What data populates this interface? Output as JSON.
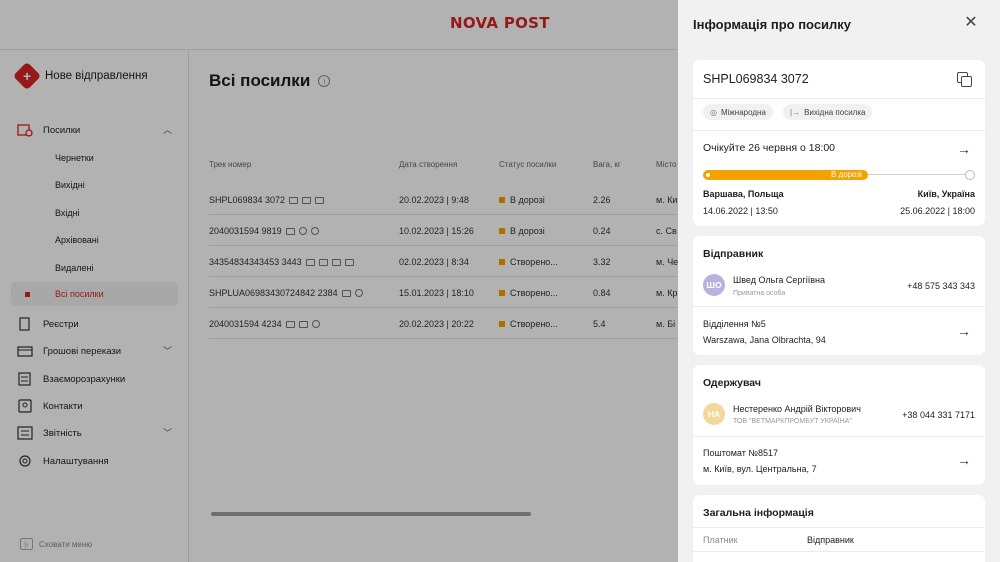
{
  "header": {
    "logo": "NOVA POST"
  },
  "sidebar": {
    "new_shipment": "Нове відправлення",
    "parcels": "Посилки",
    "sub_items": [
      "Чернетки",
      "Вихідні",
      "Вхідні",
      "Архівовані",
      "Видалені"
    ],
    "active_sub": "Всі посилки",
    "items": [
      "Реєстри",
      "Грошові перекази",
      "Взаєморозрахунки",
      "Контакти",
      "Звітність",
      "Налаштування"
    ],
    "hide_menu": "Сховати меню"
  },
  "main": {
    "title": "Всі посилки",
    "columns": [
      "Трек номер",
      "Дата  створення",
      "Статус посилки",
      "Вага, кг",
      "Місто"
    ],
    "rows": [
      {
        "track": "SHPL069834 3072",
        "date": "20.02.2023 | 9:48",
        "status": "В дорозі",
        "weight": "2.26",
        "city": "м. Ки"
      },
      {
        "track": "2040031594 9819",
        "date": "10.02.2023 | 15:26",
        "status": "В дорозі",
        "weight": "0.24",
        "city": "с. Св"
      },
      {
        "track": "34354834343453 3443",
        "date": "02.02.2023 | 8:34",
        "status": "Створено...",
        "weight": "3.32",
        "city": "м. Че"
      },
      {
        "track": "SHPLUA06983430724842 2384",
        "date": "15.01.2023 | 18:10",
        "status": "Створено...",
        "weight": "0.84",
        "city": "м. Кр"
      },
      {
        "track": "2040031594 4234",
        "date": "20.02.2023 | 20:22",
        "status": "Створено...",
        "weight": "5.4",
        "city": "м. Бі"
      }
    ]
  },
  "drawer": {
    "title": "Інформація про посилку",
    "track": "SHPL069834 3072",
    "tags": [
      "Міжнародна",
      "Вихідна посилка"
    ],
    "expected": "Очікуйте 26 червня о 18:00",
    "progress_label": "В дорозі",
    "progress_fraction": 0.62,
    "from_city": "Варшава, Польща",
    "to_city": "Київ, Україна",
    "from_date": "14.06.2022 | 13:50",
    "to_date": "25.06.2022 | 18:00",
    "sender": {
      "title": "Відправник",
      "initials": "ШО",
      "name": "Швед Ольга Сергіївна",
      "type": "Приватна особа",
      "phone": "+48 575 343 343",
      "branch": "Відділення №5",
      "address": "Warszawa, Jana Olbrachta, 94"
    },
    "recipient": {
      "title": "Одержувач",
      "initials": "НА",
      "name": "Нестеренко Андрій Вікторович",
      "company": "ТОВ \"ВЕТМАРКПРОМБУТ УКРАЇНА\"",
      "phone": "+38 044 331 7171",
      "branch": "Поштомат №8517",
      "address": "м. Київ, вул. Центральна, 7"
    },
    "general": {
      "title": "Загальна інформація",
      "payer_label": "Платник",
      "payer_value": "Відправник"
    }
  },
  "colors": {
    "brand_red": "#d92324",
    "progress_orange": "#f5a200",
    "sender_avatar": "#b8b3dc",
    "recipient_avatar": "#f3d79b"
  }
}
